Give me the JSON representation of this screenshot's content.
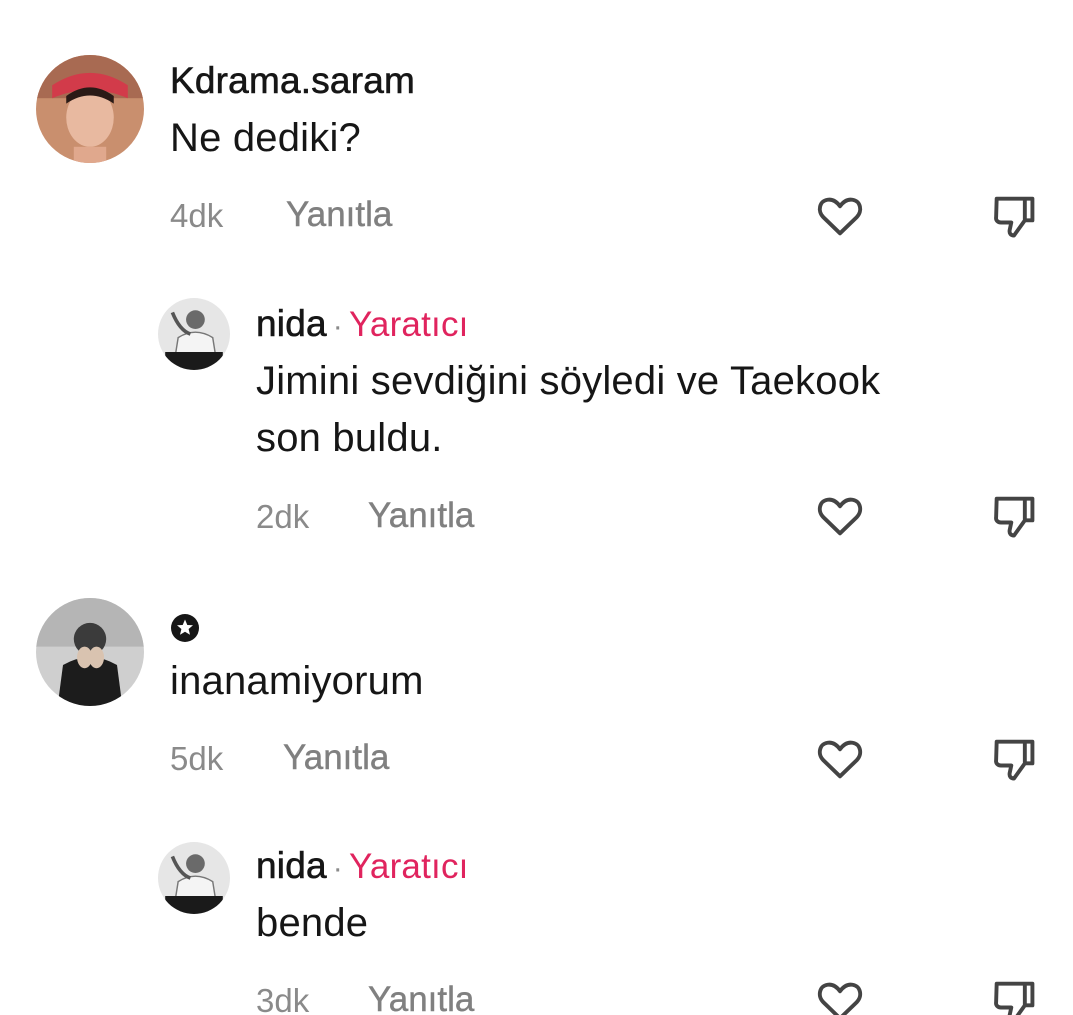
{
  "comments": [
    {
      "username": "Kdrama.saram",
      "text": "Ne dediki?",
      "time": "4dk",
      "reply_label": "Yanıtla",
      "icons": {
        "like": "heart-icon",
        "dislike": "thumbs-down-icon"
      }
    },
    {
      "username": "nida",
      "separator": "·",
      "badge": "Yaratıcı",
      "text_line1": "Jimini sevdiğini söyledi ve Taekook",
      "text_line2": "son buldu.",
      "time": "2dk",
      "reply_label": "Yanıtla"
    },
    {
      "username_icon": "star-circle-icon",
      "text": "inanamiyorum",
      "time": "5dk",
      "reply_label": "Yanıtla"
    },
    {
      "username": "nida",
      "separator": "·",
      "badge": "Yaratıcı",
      "text": "bende",
      "time": "3dk",
      "reply_label": "Yanıtla"
    }
  ],
  "colors": {
    "text": "#161616",
    "secondary": "#8a8a8a",
    "creator_badge": "#e0245e"
  }
}
